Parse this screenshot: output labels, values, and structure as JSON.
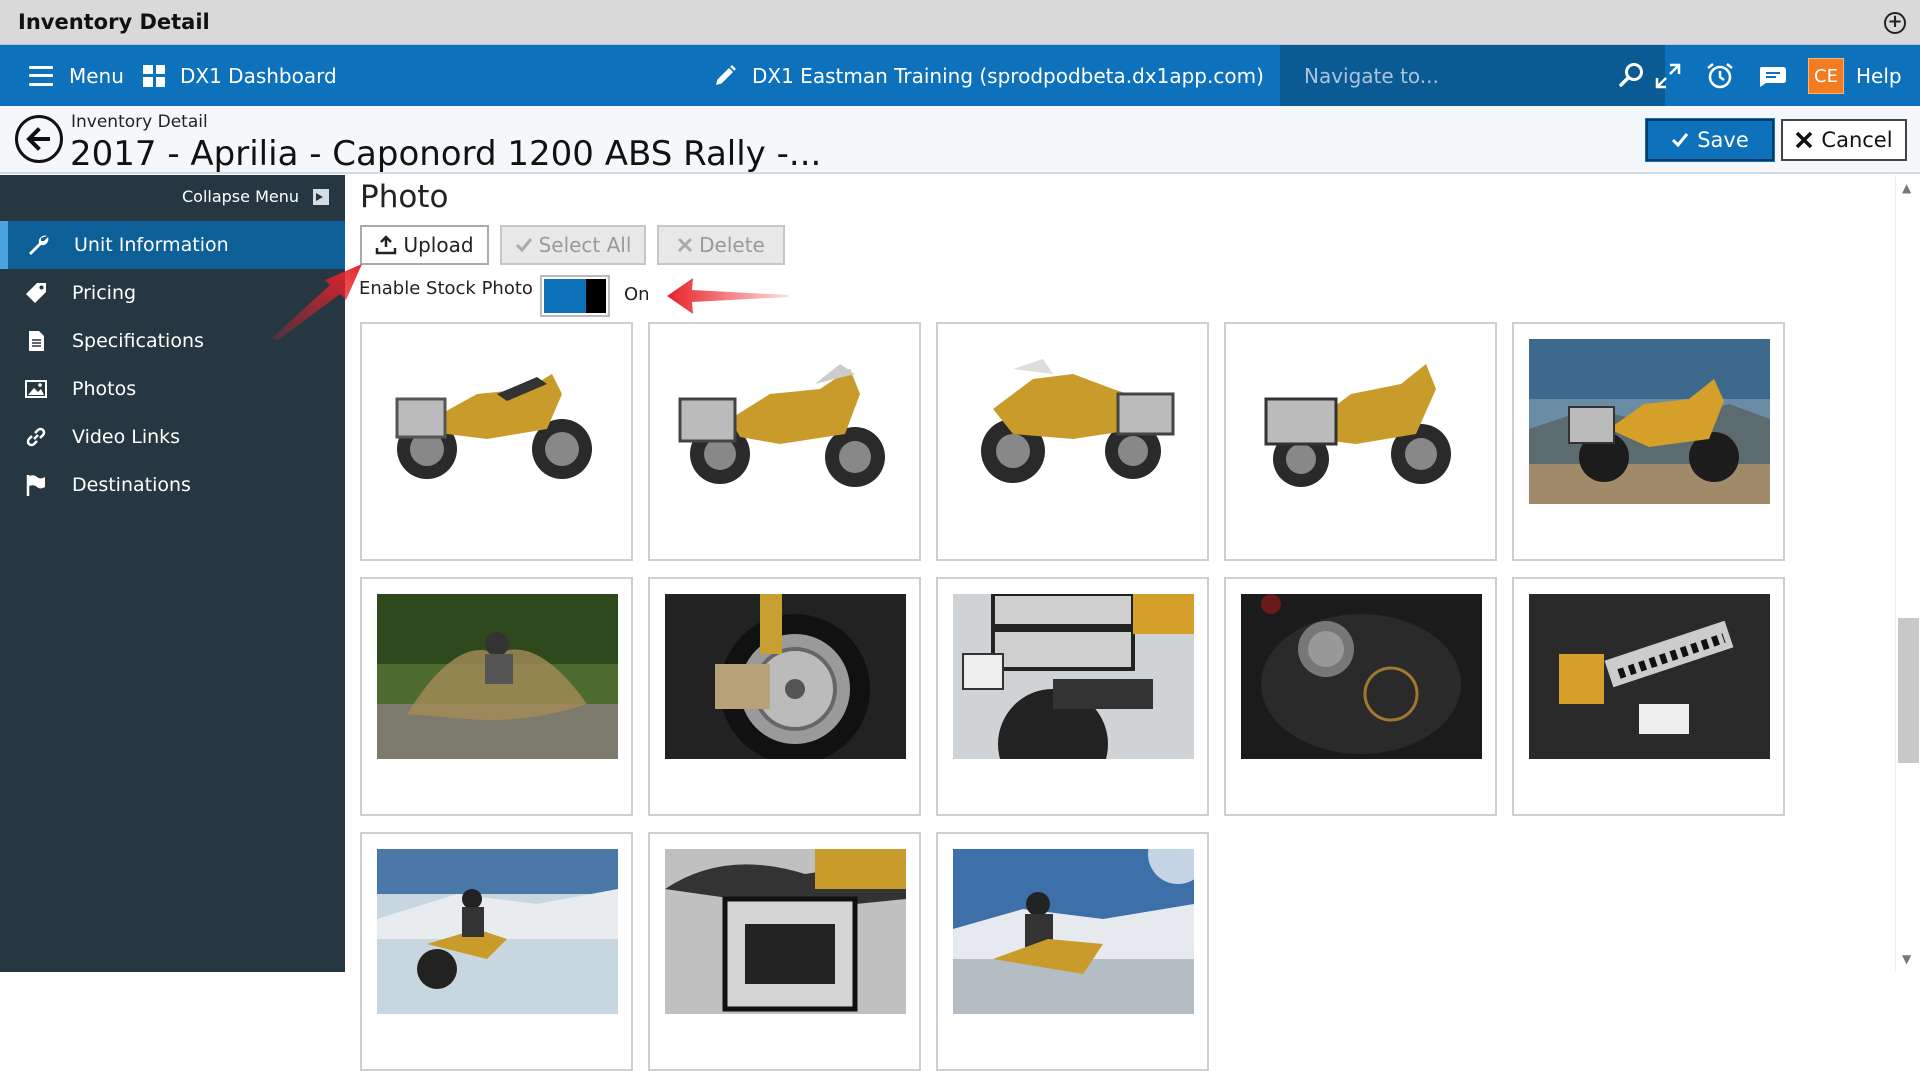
{
  "window": {
    "title": "Inventory Detail"
  },
  "topnav": {
    "menu_label": "Menu",
    "dashboard_label": "DX1 Dashboard",
    "org_label": "DX1 Eastman Training (sprodpodbeta.dx1app.com)",
    "search_placeholder": "Navigate to...",
    "avatar_initials": "CE",
    "help_label": "Help",
    "bar_color": "#0d72bb"
  },
  "header": {
    "breadcrumb": "Inventory Detail",
    "title": "2017 - Aprilia - Caponord 1200 ABS Rally -...",
    "save_label": "Save",
    "cancel_label": "Cancel"
  },
  "sidebar": {
    "collapse_label": "Collapse Menu",
    "items": [
      {
        "label": "Unit Information",
        "icon": "wrench-icon",
        "active": true
      },
      {
        "label": "Pricing",
        "icon": "tag-icon"
      },
      {
        "label": "Specifications",
        "icon": "document-icon"
      },
      {
        "label": "Photos",
        "icon": "image-icon"
      },
      {
        "label": "Video Links",
        "icon": "link-icon"
      },
      {
        "label": "Destinations",
        "icon": "flag-icon"
      }
    ]
  },
  "photo_section": {
    "title": "Photo",
    "upload_label": "Upload",
    "select_all_label": "Select All",
    "delete_label": "Delete",
    "stock_photo_label": "Enable Stock Photo :",
    "stock_photo_state": "On",
    "stock_photo_enabled": true
  }
}
